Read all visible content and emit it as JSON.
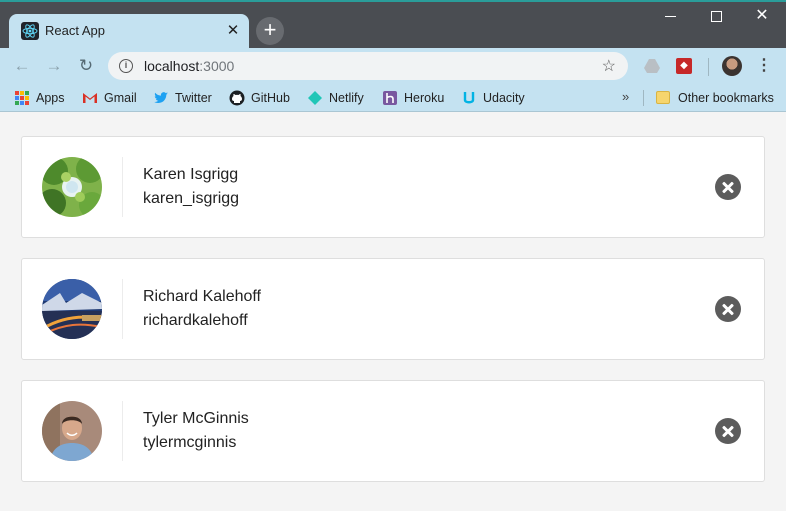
{
  "browser": {
    "tab": {
      "title": "React App",
      "favicon": "react-icon"
    },
    "new_tab_label": "+",
    "address": {
      "host": "localhost",
      "port": ":3000"
    },
    "bookmarks": [
      {
        "label": "Apps",
        "icon": "apps-grid-icon"
      },
      {
        "label": "Gmail",
        "icon": "gmail-icon"
      },
      {
        "label": "Twitter",
        "icon": "twitter-icon"
      },
      {
        "label": "GitHub",
        "icon": "github-icon"
      },
      {
        "label": "Netlify",
        "icon": "netlify-icon"
      },
      {
        "label": "Heroku",
        "icon": "heroku-icon"
      },
      {
        "label": "Udacity",
        "icon": "udacity-icon"
      }
    ],
    "overflow_label": "»",
    "other_bookmarks": "Other bookmarks"
  },
  "contacts": [
    {
      "name": "Karen Isgrigg",
      "handle": "karen_isgrigg",
      "avatar": "trees-photo"
    },
    {
      "name": "Richard Kalehoff",
      "handle": "richardkalehoff",
      "avatar": "city-bridge-photo"
    },
    {
      "name": "Tyler McGinnis",
      "handle": "tylermcginnis",
      "avatar": "portrait-photo"
    }
  ],
  "colors": {
    "titlebar": "#4a4d52",
    "toolbar": "#c4e2f1",
    "page_background": "#f4f4f4",
    "remove_button": "#5c5c5c"
  }
}
